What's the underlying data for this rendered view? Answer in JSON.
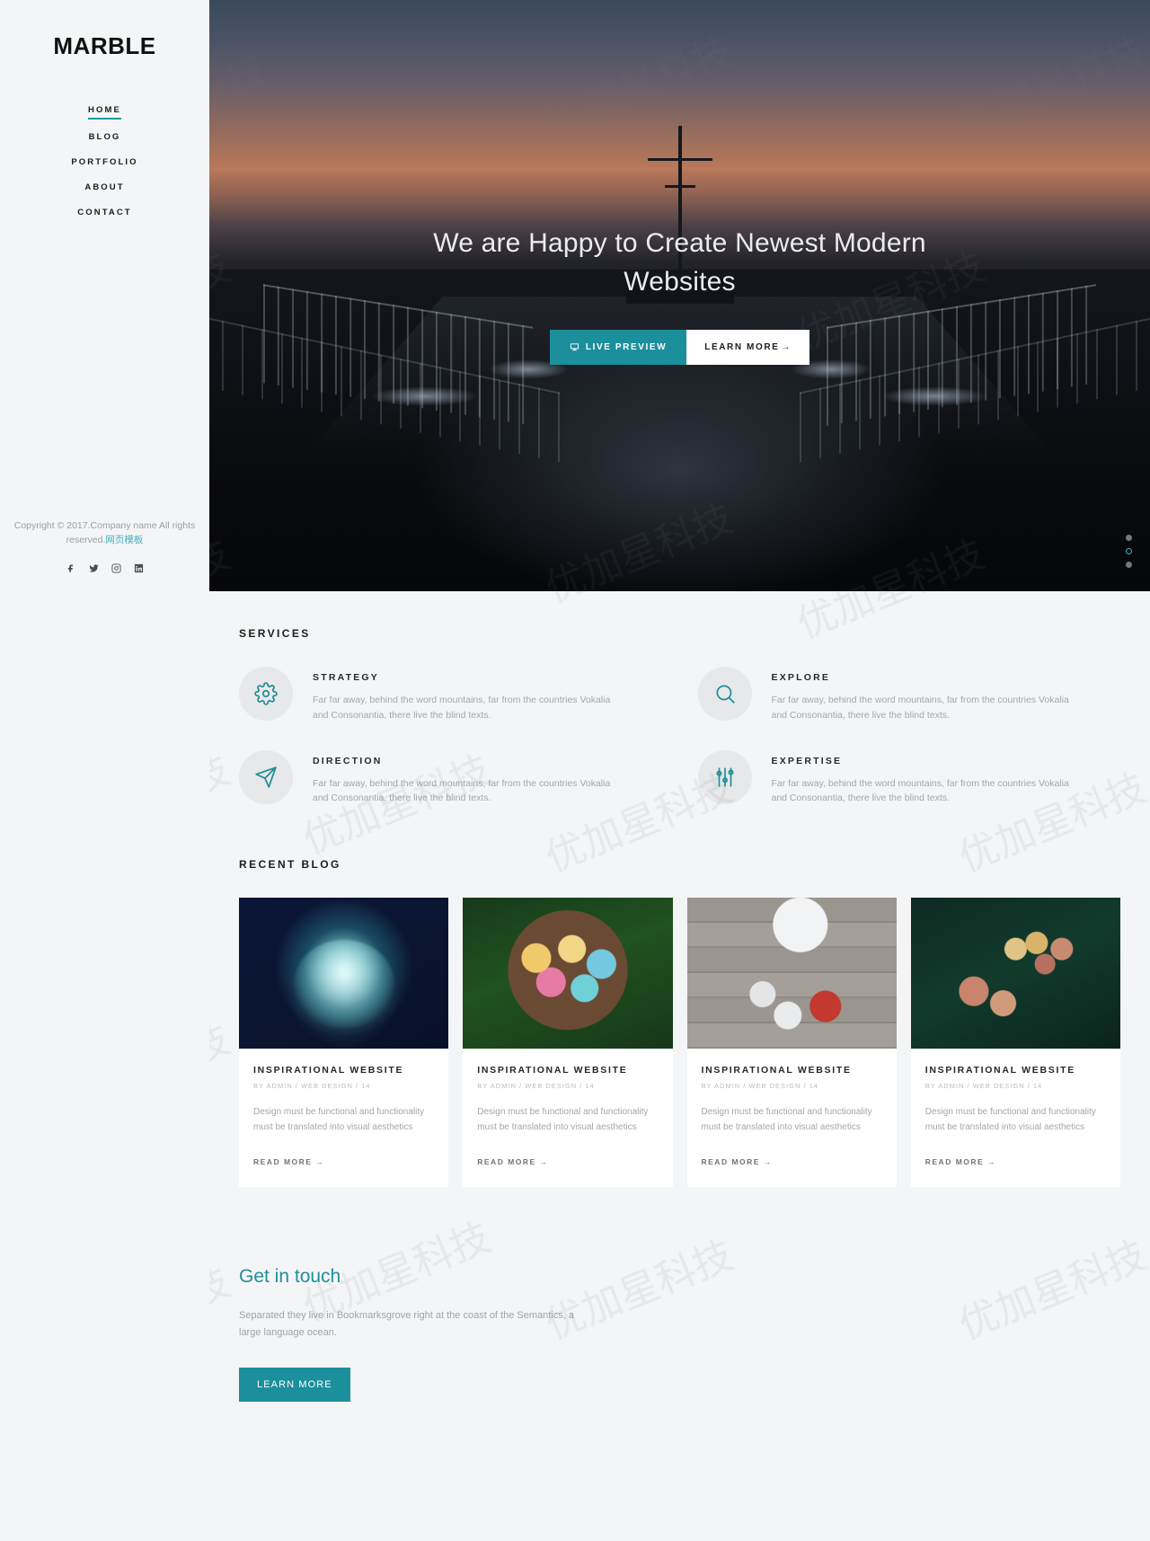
{
  "sidebar": {
    "brand": "MARBLE",
    "nav": [
      {
        "label": "HOME",
        "active": true
      },
      {
        "label": "BLOG",
        "active": false
      },
      {
        "label": "PORTFOLIO",
        "active": false
      },
      {
        "label": "ABOUT",
        "active": false
      },
      {
        "label": "CONTACT",
        "active": false
      }
    ],
    "copyright": "Copyright © 2017.Company name All rights reserved.",
    "copyright_link": "网页模板",
    "social": [
      {
        "name": "facebook-icon"
      },
      {
        "name": "twitter-icon"
      },
      {
        "name": "instagram-icon"
      },
      {
        "name": "linkedin-icon"
      }
    ]
  },
  "hero": {
    "title": "We are Happy to Create Newest Modern Websites",
    "primary_button": "LIVE PREVIEW",
    "secondary_button": "LEARN MORE",
    "secondary_button_arrow": "→",
    "dots": [
      {
        "active": false
      },
      {
        "active": true
      },
      {
        "active": false
      }
    ]
  },
  "services": {
    "title": "SERVICES",
    "items": [
      {
        "icon": "gear-icon",
        "title": "STRATEGY",
        "desc": "Far far away, behind the word mountains, far from the countries Vokalia and Consonantia, there live the blind texts."
      },
      {
        "icon": "magnifier-icon",
        "title": "EXPLORE",
        "desc": "Far far away, behind the word mountains, far from the countries Vokalia and Consonantia, there live the blind texts."
      },
      {
        "icon": "paper-plane-icon",
        "title": "DIRECTION",
        "desc": "Far far away, behind the word mountains, far from the countries Vokalia and Consonantia, there live the blind texts."
      },
      {
        "icon": "sliders-icon",
        "title": "EXPERTISE",
        "desc": "Far far away, behind the word mountains, far from the countries Vokalia and Consonantia, there live the blind texts."
      }
    ]
  },
  "recent_blog": {
    "title": "RECENT BLOG",
    "posts": [
      {
        "thumb": "jellyfish-image",
        "title": "INSPIRATIONAL WEBSITE",
        "meta": "BY ADMIN / WEB DESIGN / 14",
        "excerpt": "Design must be functional and functionality must be translated into visual aesthetics",
        "read_more": "READ MORE →"
      },
      {
        "thumb": "easter-eggs-image",
        "title": "INSPIRATIONAL WEBSITE",
        "meta": "BY ADMIN / WEB DESIGN / 14",
        "excerpt": "Design must be functional and functionality must be translated into visual aesthetics",
        "read_more": "READ MORE →"
      },
      {
        "thumb": "christmas-ornaments-image",
        "title": "INSPIRATIONAL WEBSITE",
        "meta": "BY ADMIN / WEB DESIGN / 14",
        "excerpt": "Design must be functional and functionality must be translated into visual aesthetics",
        "read_more": "READ MORE →"
      },
      {
        "thumb": "sewing-threads-image",
        "title": "INSPIRATIONAL WEBSITE",
        "meta": "BY ADMIN / WEB DESIGN / 14",
        "excerpt": "Design must be functional and functionality must be translated into visual aesthetics",
        "read_more": "READ MORE →"
      }
    ]
  },
  "get_in_touch": {
    "title": "Get in touch",
    "text": "Separated they live in Bookmarksgrove right at the coast of the Semantics, a large language ocean.",
    "button": "LEARN MORE"
  },
  "colors": {
    "accent": "#1b8f9c",
    "accent_light": "#3fb7c4",
    "page_bg": "#f4f5f6",
    "text_dark": "#1c1c1c",
    "text_muted": "#a2a7ab"
  },
  "watermark": "优加星科技"
}
